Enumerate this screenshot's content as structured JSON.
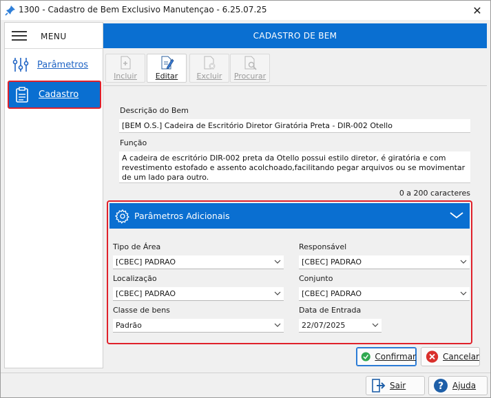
{
  "window": {
    "title": "1300 - Cadastro de Bem Exclusivo Manutençao - 6.25.07.25",
    "close_glyph": "✕"
  },
  "sidebar": {
    "menu_label": "MENU",
    "items": [
      {
        "label": "Parâmetros",
        "icon": "sliders-icon"
      },
      {
        "label": "Cadastro",
        "icon": "clipboard-icon",
        "selected": true
      }
    ]
  },
  "header": {
    "title": "CADASTRO DE BEM"
  },
  "toolbar": {
    "buttons": [
      {
        "label": "Incluir",
        "enabled": false,
        "icon": "add-document-icon"
      },
      {
        "label": "Editar",
        "enabled": true,
        "icon": "edit-document-icon"
      },
      {
        "label": "Excluir",
        "enabled": false,
        "icon": "delete-document-icon"
      },
      {
        "label": "Procurar",
        "enabled": false,
        "icon": "search-document-icon"
      }
    ]
  },
  "form": {
    "descricao_label": "Descrição do Bem",
    "descricao_value": "[BEM O.S.] Cadeira de Escritório Diretor Giratória Preta - DIR-002 Otello",
    "funcao_label": "Função",
    "funcao_value": "A cadeira de escritório DIR-002 preta da Otello possui estilo diretor, é giratória e com revestimento estofado e assento acolchoado,facilitando pegar arquivos ou se movimentar de um lado para outro.",
    "char_count": "0 a 200 caracteres"
  },
  "panel": {
    "title": "Parâmetros Adicionais",
    "fields": {
      "tipo_area_label": "Tipo de Área",
      "tipo_area_value": "[CBEC] PADRAO",
      "responsavel_label": "Responsável",
      "responsavel_value": "[CBEC] PADRAO",
      "localizacao_label": "Localização",
      "localizacao_value": "[CBEC] PADRAO",
      "conjunto_label": "Conjunto",
      "conjunto_value": "[CBEC] PADRAO",
      "classe_label": "Classe de bens",
      "classe_value": "Padrão",
      "data_entrada_label": "Data de Entrada",
      "data_entrada_value": "22/07/2025"
    }
  },
  "actions": {
    "confirmar": "Confirmar",
    "cancelar": "Cancelar",
    "sair": "Sair",
    "ajuda": "Ajuda"
  },
  "colors": {
    "accent": "#0a6fd1",
    "highlight_border": "#e0202a",
    "confirm_green": "#2fa84f",
    "cancel_red": "#d9302c",
    "help_blue": "#1e5fa8"
  }
}
